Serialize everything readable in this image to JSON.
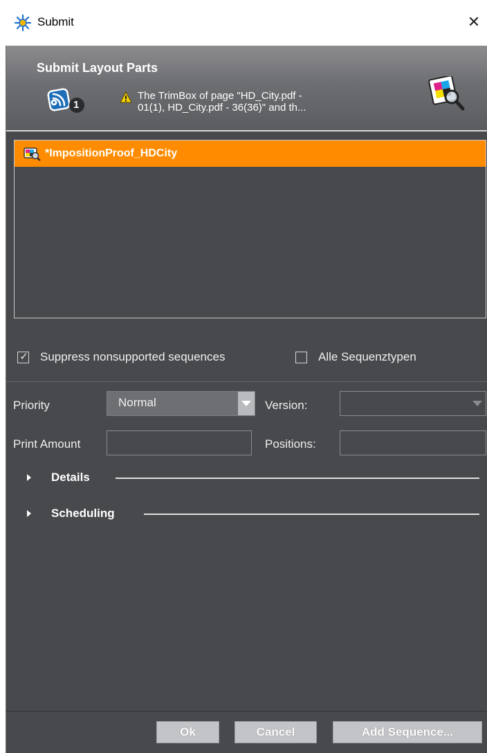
{
  "window": {
    "title": "Submit",
    "close_symbol": "✕",
    "app_icon": "submit-app-icon"
  },
  "header": {
    "title": "Submit Layout Parts",
    "job_count": "1",
    "warning_line1": "The TrimBox of page \"HD_City.pdf -",
    "warning_line2": "01(1), HD_City.pdf - 36(36)\" and th...",
    "icons": [
      "jobs-icon",
      "warning-icon",
      "proof-preview-icon"
    ]
  },
  "list": {
    "items": [
      {
        "label": "*ImpositionProof_HDCity",
        "selected": true,
        "icon": "imposition-proof-icon"
      }
    ]
  },
  "options": {
    "suppress_label": "Suppress nonsupported sequences",
    "suppress_checked": true,
    "all_types_label": "Alle Sequenztypen",
    "all_types_checked": false,
    "check_mark": "✓"
  },
  "form": {
    "priority_label": "Priority",
    "priority_value": "Normal",
    "version_label": "Version:",
    "version_value": "",
    "print_amount_label": "Print Amount",
    "print_amount_value": "",
    "positions_label": "Positions:",
    "positions_value": ""
  },
  "sections": [
    {
      "title": "Details",
      "expanded": false
    },
    {
      "title": "Scheduling",
      "expanded": false
    }
  ],
  "buttons": {
    "ok": "Ok",
    "cancel": "Cancel",
    "add_sequence": "Add Sequence..."
  },
  "colors": {
    "selection": "#ff8c00",
    "panel": "#48494d",
    "warning": "#f5d000"
  }
}
